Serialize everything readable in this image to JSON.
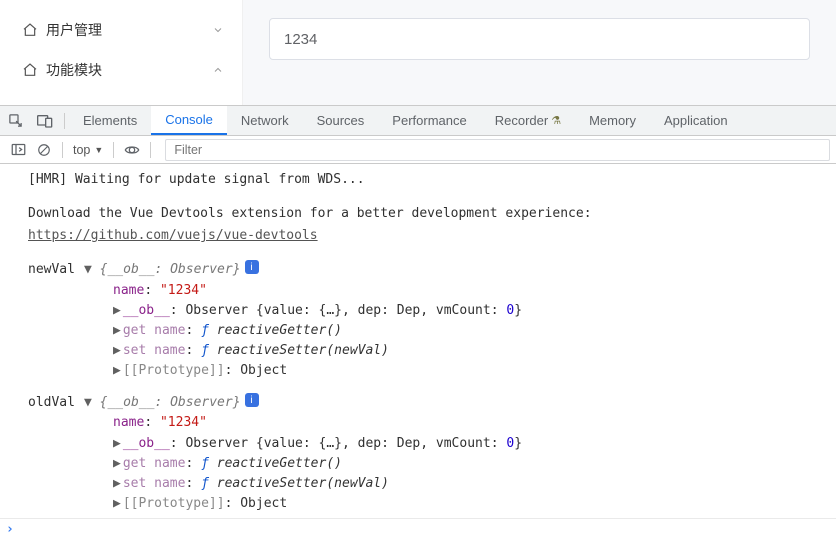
{
  "sidebar": {
    "items": [
      {
        "label": "用户管理",
        "expanded": false
      },
      {
        "label": "功能模块",
        "expanded": true
      }
    ]
  },
  "main": {
    "input_value": "1234"
  },
  "devtools": {
    "tabs": [
      "Elements",
      "Console",
      "Network",
      "Sources",
      "Performance",
      "Recorder",
      "Memory",
      "Application"
    ],
    "active_tab": "Console",
    "toolbar": {
      "context": "top",
      "filter_placeholder": "Filter"
    },
    "logs": {
      "hmr": "[HMR] Waiting for update signal from WDS...",
      "dl1": "Download the Vue Devtools extension for a better development experience:",
      "dl2": "https://github.com/vuejs/vue-devtools",
      "newVal": {
        "label": "newVal",
        "summary": "{__ob__: Observer}",
        "name_key": "name",
        "name_val": "\"1234\"",
        "ob_key": "__ob__",
        "ob_val_pre": "Observer {value: {…}, dep: Dep, vmCount: ",
        "ob_val_num": "0",
        "ob_val_post": "}",
        "get_key": "get name",
        "get_val": "reactiveGetter()",
        "set_key": "set name",
        "set_val": "reactiveSetter(newVal)",
        "proto_key": "[[Prototype]]",
        "proto_val": "Object"
      },
      "oldVal": {
        "label": "oldVal",
        "summary": "{__ob__: Observer}",
        "name_key": "name",
        "name_val": "\"1234\"",
        "ob_key": "__ob__",
        "ob_val_pre": "Observer {value: {…}, dep: Dep, vmCount: ",
        "ob_val_num": "0",
        "ob_val_post": "}",
        "get_key": "get name",
        "get_val": "reactiveGetter()",
        "set_key": "set name",
        "set_val": "reactiveSetter(newVal)",
        "proto_key": "[[Prototype]]",
        "proto_val": "Object"
      }
    }
  },
  "glyph": {
    "f": "ƒ"
  }
}
